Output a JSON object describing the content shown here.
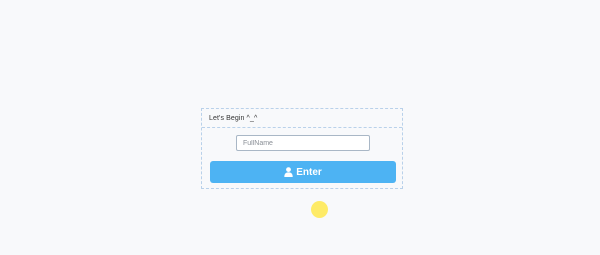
{
  "panel": {
    "heading": "Let's Begin ^_^"
  },
  "form": {
    "name_input": {
      "value": "",
      "placeholder": "FullName"
    },
    "enter_button": {
      "label": "Enter",
      "icon": "user-icon"
    }
  },
  "colors": {
    "button": "#4db3f3",
    "cursor": "#ffe94c",
    "background": "#f8f9fb"
  }
}
